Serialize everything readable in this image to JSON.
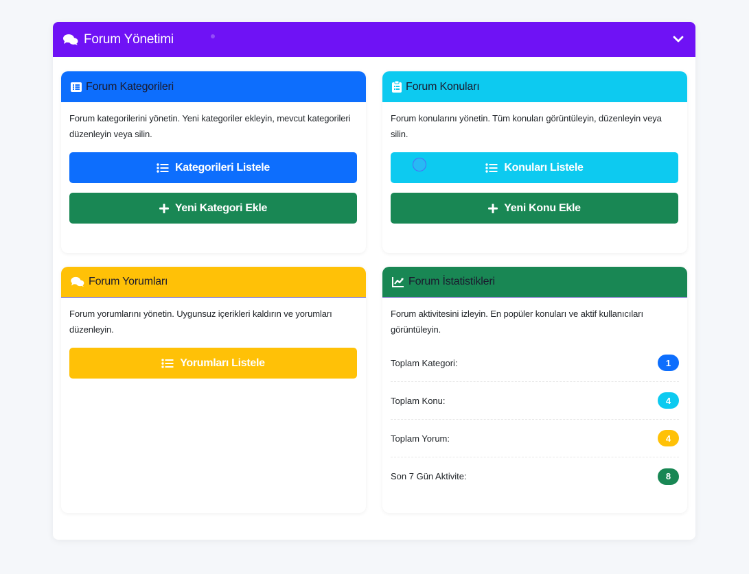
{
  "header": {
    "title": "Forum Yönetimi"
  },
  "cards": {
    "categories": {
      "title": "Forum Kategorileri",
      "description": "Forum kategorilerini yönetin. Yeni kategoriler ekleyin, mevcut kategorileri düzenleyin veya silin.",
      "list_button": "Kategorileri Listele",
      "add_button": "Yeni Kategori Ekle"
    },
    "topics": {
      "title": "Forum Konuları",
      "description": "Forum konularını yönetin. Tüm konuları görüntüleyin, düzenleyin veya silin.",
      "list_button": "Konuları Listele",
      "add_button": "Yeni Konu Ekle"
    },
    "comments": {
      "title": "Forum Yorumları",
      "description": "Forum yorumlarını yönetin. Uygunsuz içerikleri kaldırın ve yorumları düzenleyin.",
      "list_button": "Yorumları Listele"
    },
    "stats": {
      "title": "Forum İstatistikleri",
      "description": "Forum aktivitesini izleyin. En popüler konuları ve aktif kullanıcıları görüntüleyin.",
      "rows": [
        {
          "label": "Toplam Kategori:",
          "value": "1",
          "color": "#0d6efd"
        },
        {
          "label": "Toplam Konu:",
          "value": "4",
          "color": "#0dcaf0"
        },
        {
          "label": "Toplam Yorum:",
          "value": "4",
          "color": "#ffc107"
        },
        {
          "label": "Son 7 Gün Aktivite:",
          "value": "8",
          "color": "#198754"
        }
      ]
    }
  },
  "colors": {
    "header": "#6f12f5",
    "primary": "#0d6efd",
    "info": "#0dcaf0",
    "warning": "#ffc107",
    "success": "#198754"
  },
  "icons": {
    "header": "comments-icon",
    "categories": "list-alt-icon",
    "topics": "clipboard-list-icon",
    "comments": "comments-icon",
    "stats": "chart-line-icon",
    "list": "list-icon",
    "add": "plus-icon",
    "collapse": "chevron-down-icon"
  }
}
